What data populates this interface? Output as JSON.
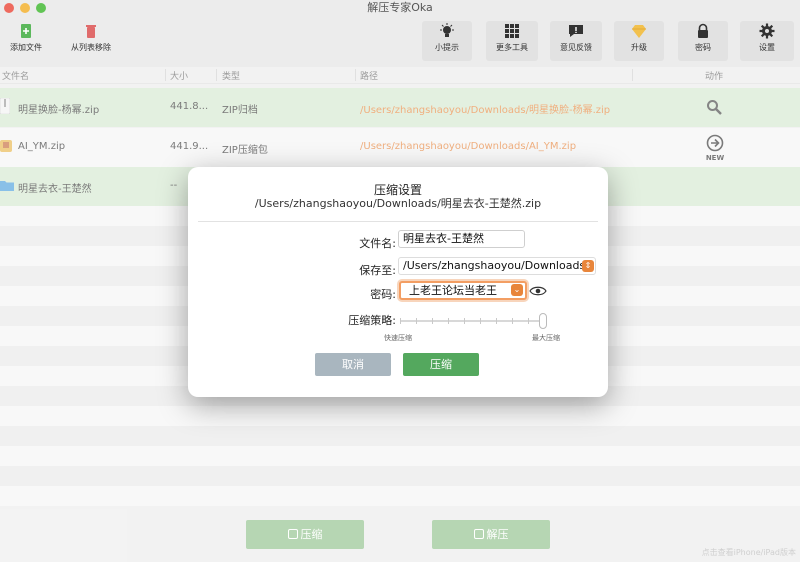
{
  "window": {
    "title": "解压专家Oka"
  },
  "toolbar": {
    "add_file": "添加文件",
    "remove": "从列表移除",
    "tips": "小提示",
    "more_tools": "更多工具",
    "feedback": "意见反馈",
    "upgrade": "升级",
    "password": "密码",
    "settings": "设置"
  },
  "table": {
    "headers": {
      "name": "文件名",
      "size": "大小",
      "type": "类型",
      "path": "路径",
      "action": "动作"
    },
    "rows": [
      {
        "name": "明星换脸-杨幂.zip",
        "size": "441.8...",
        "type": "ZIP归档",
        "path": "/Users/zhangshaoyou/Downloads/明星换脸-杨幂.zip"
      },
      {
        "name": "AI_YM.zip",
        "size": "441.9...",
        "type": "ZIP压缩包",
        "path": "/Users/zhangshaoyou/Downloads/AI_YM.zip"
      },
      {
        "name": "明星去衣-王楚然",
        "size": "--",
        "type": "",
        "path": ""
      }
    ],
    "new_badge": "NEW"
  },
  "bottom": {
    "compress": "压缩",
    "extract": "解压",
    "note": "点击查看iPhone/iPad版本"
  },
  "dialog": {
    "title": "压缩设置",
    "subtitle": "/Users/zhangshaoyou/Downloads/明星去衣-王楚然.zip",
    "filename_label": "文件名:",
    "filename_value": "明星去衣-王楚然",
    "saveto_label": "保存至:",
    "saveto_value": "/Users/zhangshaoyou/Downloads",
    "password_label": "密码:",
    "password_value": "上老王论坛当老王",
    "strategy_label": "压缩策略:",
    "strategy_level": 1.0,
    "fast_label": "快速压缩",
    "max_label": "最大压缩",
    "cancel": "取消",
    "confirm": "压缩"
  },
  "colors": {
    "accent": "#e8853b",
    "green": "#54a85e",
    "row_highlight": "#d7e9d1"
  }
}
